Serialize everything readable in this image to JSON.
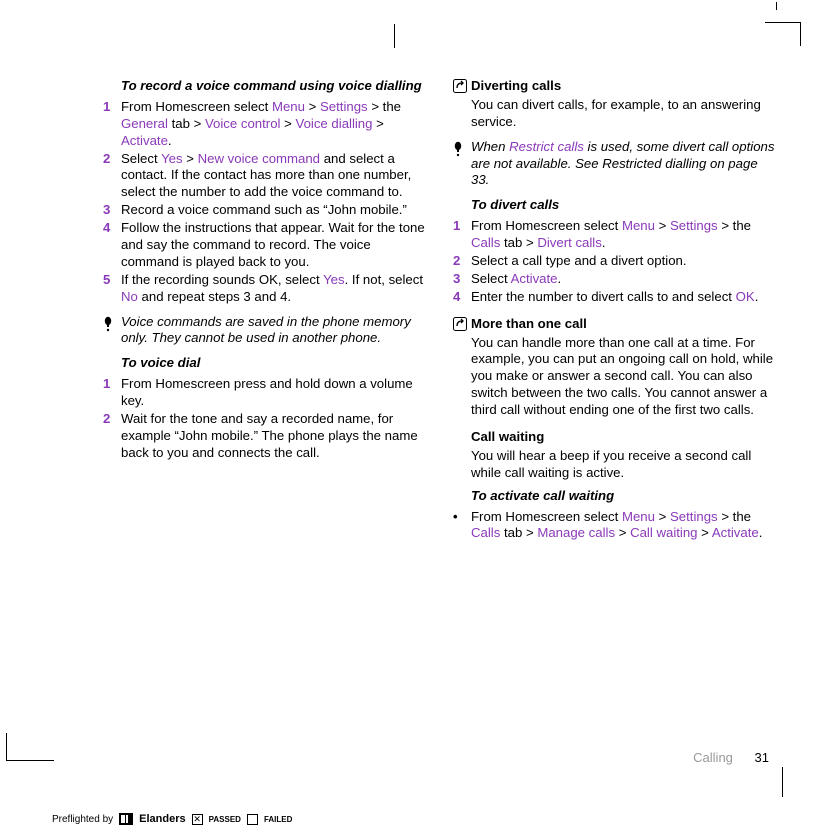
{
  "col1": {
    "title1": "To record a voice command using voice dialling",
    "s1": {
      "pre": "From Homescreen select ",
      "m1": "Menu",
      "g1": " > ",
      "m2": "Settings",
      "g2": " > the ",
      "m3": "General",
      "g3": " tab > ",
      "m4": "Voice control",
      "g4": " > ",
      "m5": "Voice dialling",
      "g5": " > ",
      "m6": "Activate",
      "g6": "."
    },
    "s2": {
      "pre": "Select ",
      "m1": "Yes",
      "g1": " > ",
      "m2": "New voice command",
      "post": " and select a contact. If the contact has more than one number, select the number to add the voice command to."
    },
    "s3": "Record a voice command such as “John mobile.”",
    "s4": "Follow the instructions that appear. Wait for the tone and say the command to record. The voice command is played back to you.",
    "s5": {
      "pre": "If the recording sounds OK, select ",
      "m1": "Yes",
      "mid": ". If not, select ",
      "m2": "No",
      "post": " and repeat steps 3 and 4."
    },
    "note1": "Voice commands are saved in the phone memory only. They cannot be used in another phone.",
    "title2": "To voice dial",
    "v1": "From Homescreen press and hold down a volume key.",
    "v2": "Wait for the tone and say a recorded name, for example “John mobile.” The phone plays the name back to you and connects the call."
  },
  "col2": {
    "head1": "Diverting calls",
    "p1": "You can divert calls, for example, to an answering service.",
    "note2": {
      "pre": "When ",
      "m1": "Restrict calls",
      "post": " is used, some divert call options are not available. See Restricted dialling on page 33."
    },
    "title3": "To divert calls",
    "d1": {
      "pre": "From Homescreen select ",
      "m1": "Menu",
      "g1": " > ",
      "m2": "Settings",
      "g2": " > the ",
      "m3": "Calls",
      "g3": " tab > ",
      "m4": "Divert calls",
      "g4": "."
    },
    "d2": "Select a call type and a divert option.",
    "d3": {
      "pre": "Select ",
      "m1": "Activate",
      "post": "."
    },
    "d4": {
      "pre": "Enter the number to divert calls to and select ",
      "m1": "OK",
      "post": "."
    },
    "head2": "More than one call",
    "p2": "You can handle more than one call at a time. For example, you can put an ongoing call on hold, while you make or answer a second call. You can also switch between the two calls. You cannot answer a third call without ending one of the first two calls.",
    "sub1": "Call waiting",
    "p3": "You will hear a beep if you receive a second call while call waiting is active.",
    "title4": "To activate call waiting",
    "c1": {
      "pre": "From Homescreen select ",
      "m1": "Menu",
      "g1": " > ",
      "m2": "Settings",
      "g2": " > the ",
      "m3": "Calls",
      "g3": " tab > ",
      "m4": "Manage calls",
      "g4": " > ",
      "m5": "Call waiting",
      "g5": " > ",
      "m6": "Activate",
      "g6": "."
    }
  },
  "footer": {
    "section": "Calling",
    "page": "31"
  },
  "preflight": {
    "label": "Preflighted by",
    "brand": "Elanders",
    "pass": "PASSED",
    "fail": "FAILED"
  },
  "nums": {
    "n1": "1",
    "n2": "2",
    "n3": "3",
    "n4": "4",
    "n5": "5",
    "bull": "•"
  }
}
